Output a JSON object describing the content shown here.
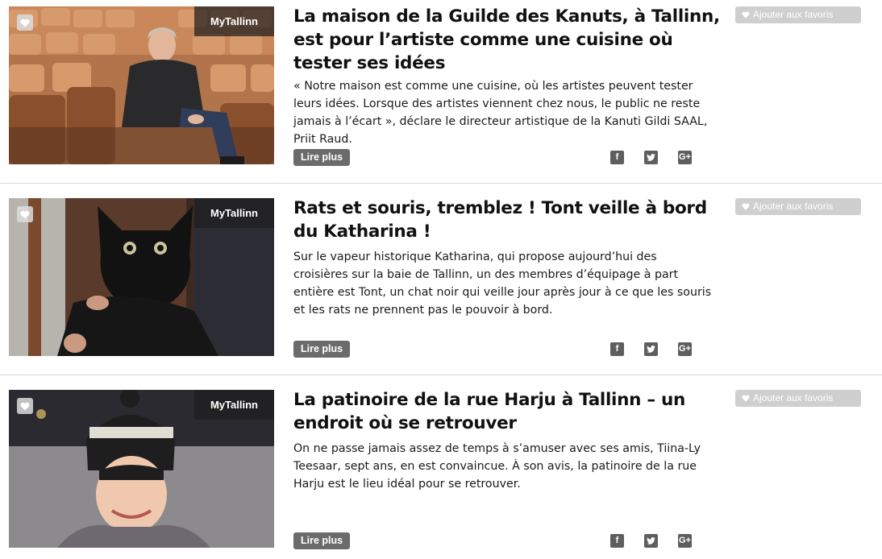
{
  "articles": [
    {
      "source": "MyTallinn",
      "title": "La maison de la Guilde des Kanuts, à Tallinn, est pour l’artiste comme une cuisine où tester ses idées",
      "excerpt": "« Notre maison est comme une cuisine, où les artistes peuvent tester leurs idées. Lorsque des artistes viennent chez nous, le public ne reste jamais à l’écart », déclare le directeur artistique de la Kanuti Gildi SAAL, Priit Raud.",
      "read_more": "Lire plus",
      "favorite_label": "Ajouter aux favoris"
    },
    {
      "source": "MyTallinn",
      "title": "Rats et souris, tremblez ! Tont veille à bord du Katharina !",
      "excerpt": "Sur le vapeur historique Katharina, qui propose aujourd’hui des croisières sur la baie de Tallinn, un des membres d’équipage à part entière est Tont, un chat noir qui veille jour après jour à ce que les souris et les rats ne prennent pas le pouvoir à bord.",
      "read_more": "Lire plus",
      "favorite_label": "Ajouter aux favoris"
    },
    {
      "source": "MyTallinn",
      "title": "La patinoire de la rue Harju à Tallinn – un endroit où se retrouver",
      "excerpt": "On ne passe jamais assez de temps à s’amuser avec ses amis, Tiina-Ly Teesaar, sept ans, en est convaincue. À son avis, la patinoire de la rue Harju est le lieu idéal pour se retrouver.",
      "read_more": "Lire plus",
      "favorite_label": "Ajouter aux favoris"
    }
  ],
  "share_icons": [
    "facebook-icon",
    "twitter-icon",
    "google-plus-icon"
  ],
  "colors": {
    "button_dark": "#6b6b6b",
    "favorite_button": "#cfcfcf",
    "divider": "#d9d9d9",
    "badge_bg": "#1e1e1e"
  }
}
